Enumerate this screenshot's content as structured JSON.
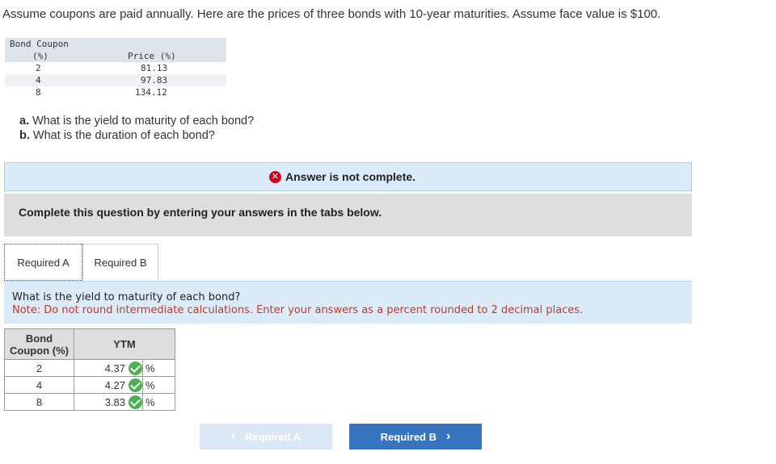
{
  "intro_text": "Assume coupons are paid annually. Here are the prices of three bonds with 10-year maturities. Assume face value is $100.",
  "given_table": {
    "header_col1_line1": "Bond Coupon",
    "header_col1_line2": "(%)",
    "header_col2": "Price (%)",
    "rows": [
      {
        "coupon": "2",
        "price": "81.13"
      },
      {
        "coupon": "4",
        "price": "97.83"
      },
      {
        "coupon": "8",
        "price": "134.12"
      }
    ]
  },
  "questions": {
    "a_label": "a.",
    "a_text": " What is the yield to maturity of each bond?",
    "b_label": "b.",
    "b_text": " What is the duration of each bond?"
  },
  "status": {
    "text": "Answer is not complete.",
    "color": "#d0021b"
  },
  "instruction": "Complete this question by entering your answers in the tabs below.",
  "tabs": [
    {
      "label": "Required A"
    },
    {
      "label": "Required B"
    }
  ],
  "prompt": {
    "question": "What is the yield to maturity of each bond?",
    "note": "Note: Do not round intermediate calculations. Enter your answers as a percent rounded to 2 decimal places."
  },
  "answer_table": {
    "header_coupon_line1": "Bond",
    "header_coupon_line2": "Coupon (%)",
    "header_ytm": "YTM",
    "rows": [
      {
        "coupon": "2",
        "ytm": "4.37",
        "unit": "%",
        "status": "check-icon"
      },
      {
        "coupon": "4",
        "ytm": "4.27",
        "unit": "%",
        "status": "check-icon"
      },
      {
        "coupon": "8",
        "ytm": "3.83",
        "unit": "%",
        "status": "check-icon"
      }
    ]
  },
  "nav": {
    "prev_label": "Required A",
    "next_label": "Required B",
    "prev_icon": "chevron-left-icon",
    "next_icon": "chevron-right-icon"
  }
}
